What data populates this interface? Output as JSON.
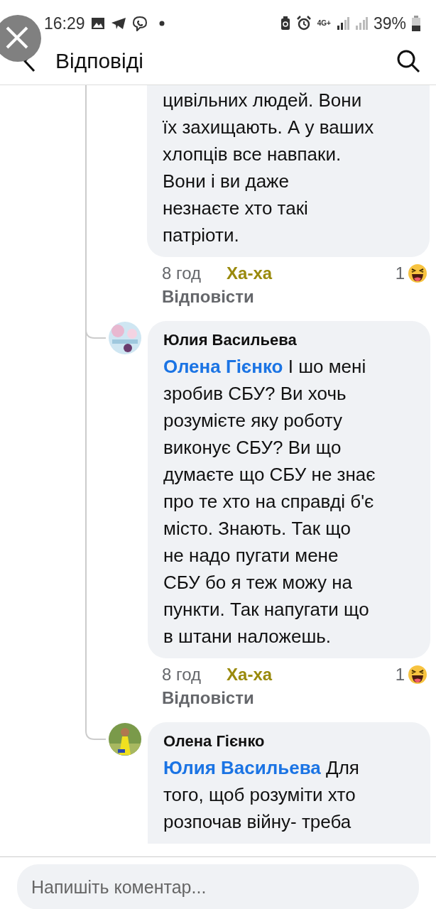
{
  "status_bar": {
    "time": "16:29",
    "network": "4G+",
    "battery": "39%"
  },
  "header": {
    "title": "Відповіді"
  },
  "comments": [
    {
      "kind": "cut-top",
      "lines": [
        "цивільних людей. Вони",
        "їх захищають. А у ваших",
        "хлопців все навпаки.",
        "Вони і ви  даже",
        "незнаєте хто такі",
        "патріоти."
      ],
      "time": "8 год",
      "reaction_label": "Ха-ха",
      "reacted": true,
      "reply": "Відповісти",
      "count": "1"
    },
    {
      "kind": "reply",
      "author": "Юлия Васильева",
      "mention": "Олена Гієнко",
      "lines": [
        "І шо мені",
        "зробив СБУ? Ви хочь",
        "розумієте яку роботу",
        "виконує СБУ? Ви що",
        "думаєте що СБУ не знає",
        "про те хто на справді б'є",
        "місто. Знають. Так що",
        "не надо пугати мене",
        "СБУ бо я теж можу на",
        "пункти. Так напугати що",
        "в штани наложешь."
      ],
      "time": "8 год",
      "reaction_label": "Ха-ха",
      "reacted": true,
      "reply": "Відповісти",
      "count": "1"
    },
    {
      "kind": "reply-cut",
      "author": "Олена Гієнко",
      "mention": "Юлия Васильева",
      "lines": [
        "Для",
        "того, щоб розуміти хто",
        "розпочав війну- треба"
      ]
    }
  ],
  "composer": {
    "placeholder": "Напишіть коментар..."
  }
}
